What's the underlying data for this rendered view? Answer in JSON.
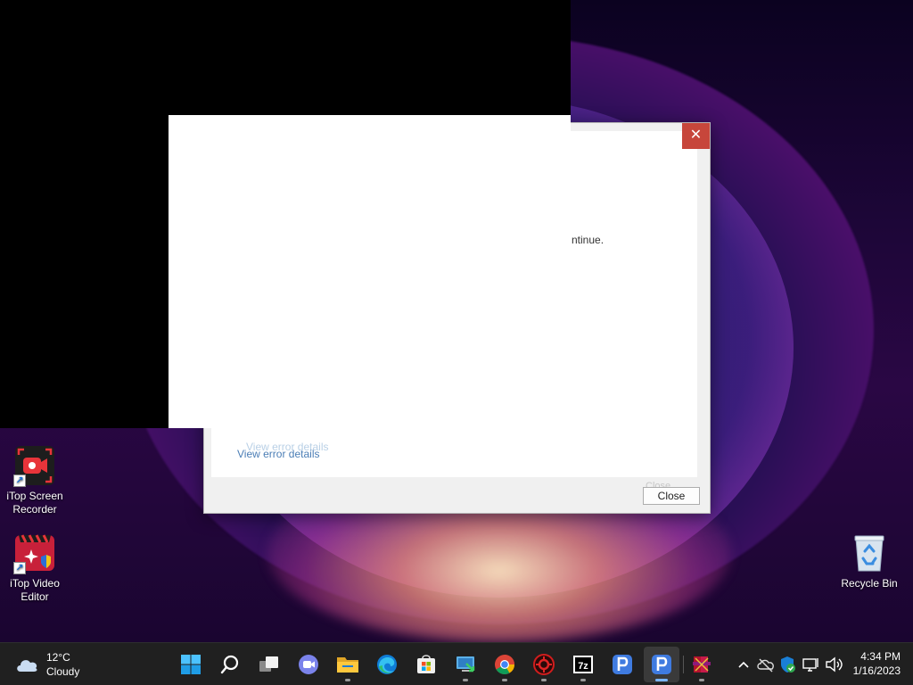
{
  "desktop": {
    "icons": [
      {
        "label": "iTop Screen Recorder"
      },
      {
        "label": "iTop Video Editor"
      },
      {
        "label": "Recycle Bin"
      }
    ]
  },
  "dialog": {
    "message_fragment": "ntinue.",
    "view_error_details": "View error details",
    "close_button": "Close",
    "close_icon": "close-icon"
  },
  "taskbar": {
    "weather": {
      "temperature": "12°C",
      "condition": "Cloudy"
    },
    "apps": [
      {
        "name": "start-icon"
      },
      {
        "name": "search-icon"
      },
      {
        "name": "task-view-icon"
      },
      {
        "name": "teams-chat-icon"
      },
      {
        "name": "file-explorer-icon"
      },
      {
        "name": "edge-icon"
      },
      {
        "name": "microsoft-store-icon"
      },
      {
        "name": "remote-desktop-icon"
      },
      {
        "name": "chrome-icon"
      },
      {
        "name": "app-red-icon"
      },
      {
        "name": "7zip-icon"
      },
      {
        "name": "p-app-icon"
      },
      {
        "name": "p-app-icon-active"
      },
      {
        "name": "winrar-icon"
      }
    ],
    "tray": {
      "icons": [
        "chevron-up-icon",
        "onedrive-icon",
        "defender-icon",
        "network-icon",
        "volume-icon"
      ]
    },
    "clock": {
      "time": "4:34 PM",
      "date": "1/16/2023"
    }
  },
  "colors": {
    "accent": "#7ab5ff",
    "close_red": "#c7463b",
    "link": "#4a7db5"
  }
}
